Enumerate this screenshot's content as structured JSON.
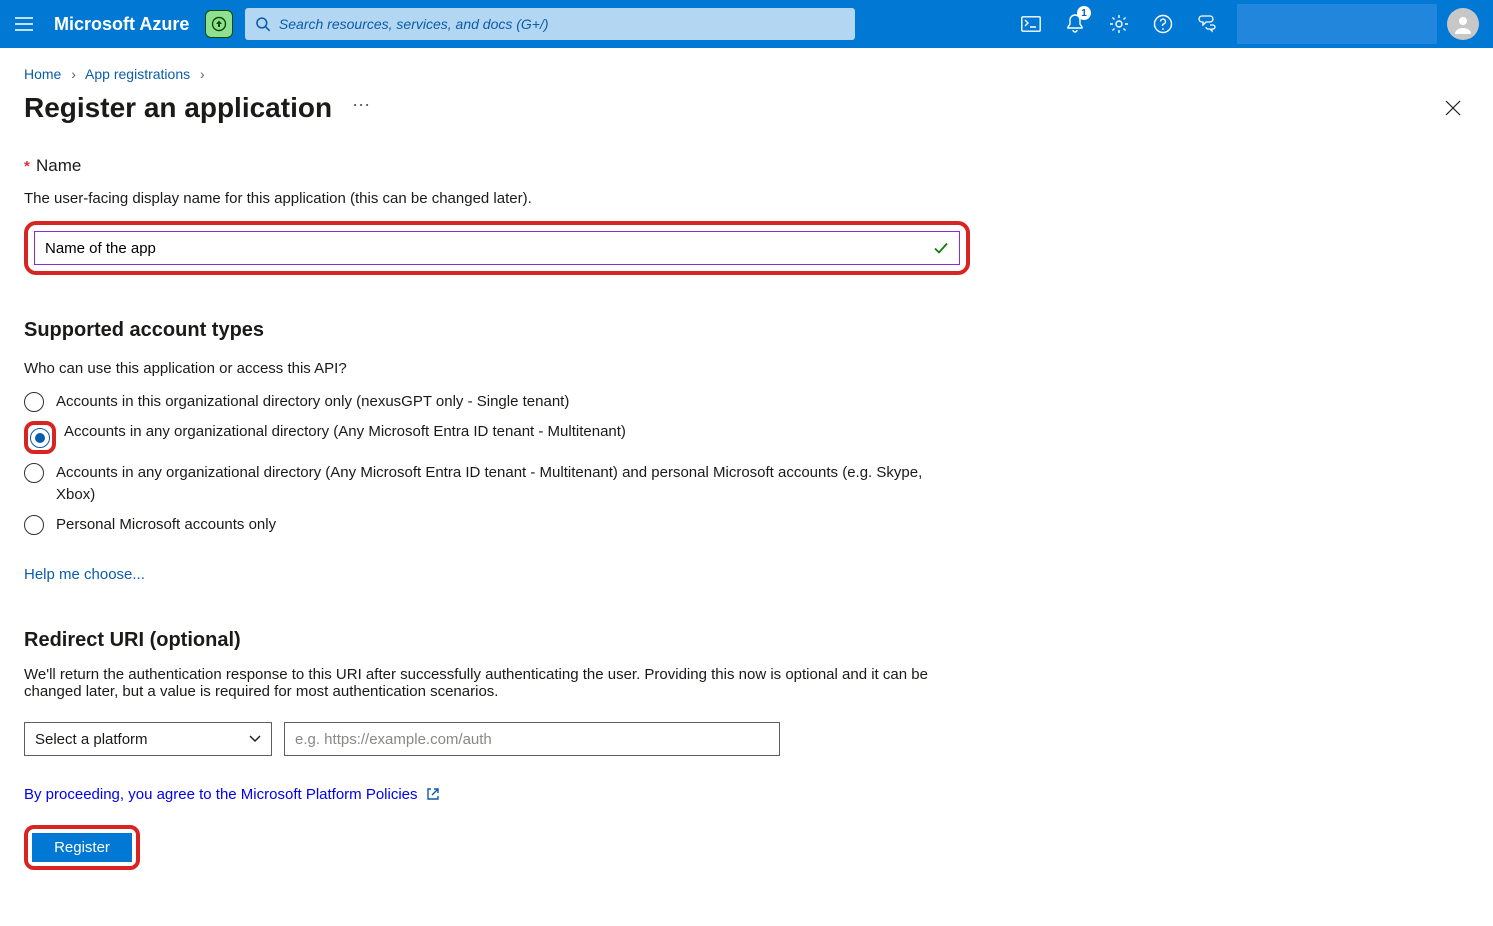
{
  "header": {
    "brand": "Microsoft Azure",
    "search_placeholder": "Search resources, services, and docs (G+/)",
    "notification_badge": "1"
  },
  "breadcrumbs": {
    "items": [
      "Home",
      "App registrations"
    ]
  },
  "page": {
    "title": "Register an application"
  },
  "name_section": {
    "required_mark": "*",
    "label": "Name",
    "description": "The user-facing display name for this application (this can be changed later).",
    "value": "Name of the app"
  },
  "account_types": {
    "heading": "Supported account types",
    "question": "Who can use this application or access this API?",
    "options": [
      "Accounts in this organizational directory only (nexusGPT only - Single tenant)",
      "Accounts in any organizational directory (Any Microsoft Entra ID tenant - Multitenant)",
      "Accounts in any organizational directory (Any Microsoft Entra ID tenant - Multitenant) and personal Microsoft accounts (e.g. Skype, Xbox)",
      "Personal Microsoft accounts only"
    ],
    "selected_index": 1,
    "help_link": "Help me choose..."
  },
  "redirect": {
    "heading": "Redirect URI (optional)",
    "description": "We'll return the authentication response to this URI after successfully authenticating the user. Providing this now is optional and it can be changed later, but a value is required for most authentication scenarios.",
    "select_placeholder": "Select a platform",
    "uri_placeholder": "e.g. https://example.com/auth"
  },
  "footer": {
    "policies_text": "By proceeding, you agree to the Microsoft Platform Policies",
    "register_label": "Register"
  }
}
